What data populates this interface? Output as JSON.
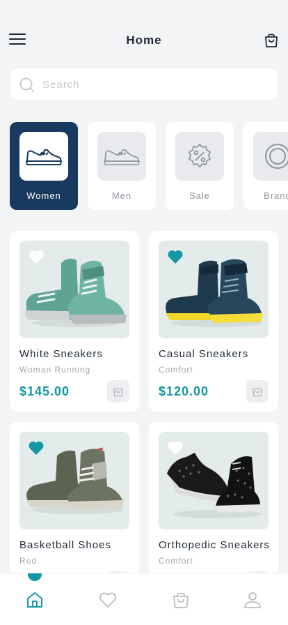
{
  "header": {
    "title": "Home"
  },
  "search": {
    "placeholder": "Search"
  },
  "categories": [
    {
      "label": "Women",
      "icon": "sneaker-icon",
      "active": true
    },
    {
      "label": "Men",
      "icon": "sneaker-icon",
      "active": false
    },
    {
      "label": "Sale",
      "icon": "discount-badge-icon",
      "active": false
    },
    {
      "label": "Brand",
      "icon": "brand-circle-icon",
      "active": false
    }
  ],
  "products": [
    {
      "name": "White Sneakers",
      "subtitle": "Woman Running",
      "price": "$145.00",
      "favorite": false
    },
    {
      "name": "Casual Sneakers",
      "subtitle": "Comfort",
      "price": "$120.00",
      "favorite": true
    },
    {
      "name": "Basketball Shoes",
      "subtitle": "Red",
      "price": "",
      "favorite": true
    },
    {
      "name": "Orthopedic Sneakers",
      "subtitle": "Comfort",
      "price": "",
      "favorite": false
    }
  ],
  "tabbar": {
    "items": [
      "home-icon",
      "heart-icon",
      "bag-icon",
      "user-icon"
    ],
    "active": "home"
  },
  "colors": {
    "accent": "#1597a6",
    "navy": "#173a5e",
    "background": "#f3f4f6"
  }
}
